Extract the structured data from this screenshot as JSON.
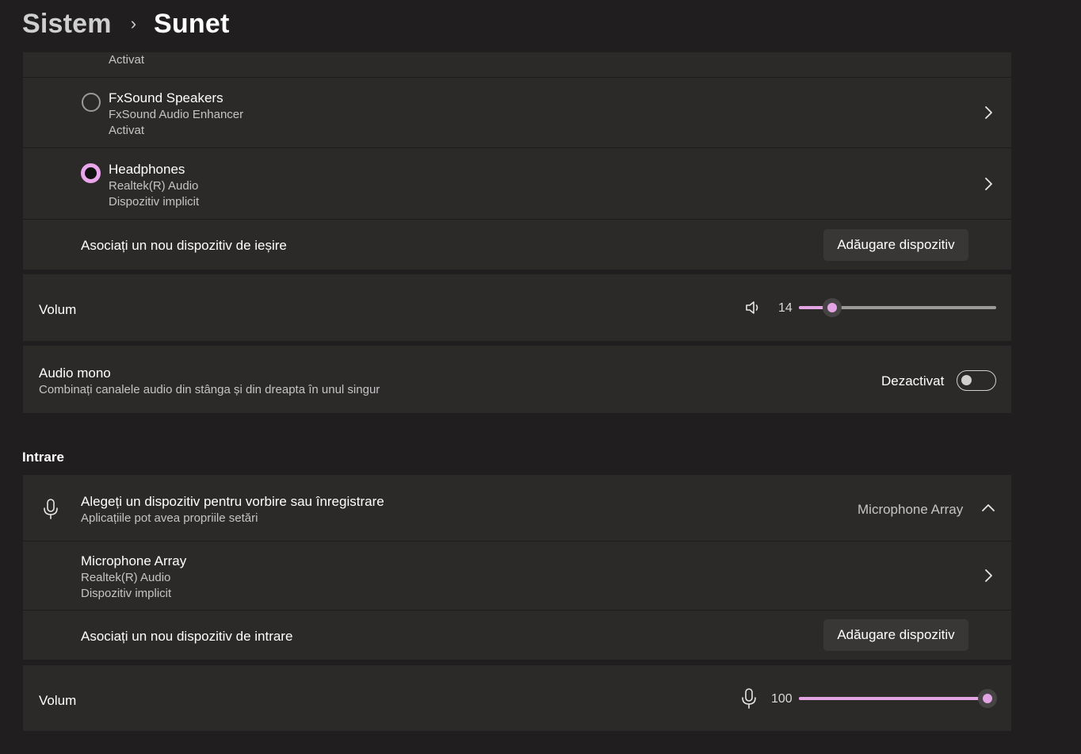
{
  "breadcrumb": {
    "parent": "Sistem",
    "separator": "›",
    "current": "Sunet"
  },
  "output": {
    "partial_status": "Activat",
    "devices": [
      {
        "name": "FxSound Speakers",
        "driver": "FxSound Audio Enhancer",
        "status": "Activat",
        "selected": false
      },
      {
        "name": "Headphones",
        "driver": "Realtek(R) Audio",
        "status": "Dispozitiv implicit",
        "selected": true
      }
    ],
    "pair_label": "Asociați un nou dispozitiv de ieșire",
    "add_button": "Adăugare dispozitiv",
    "volume": {
      "label": "Volum",
      "value": "14",
      "level": 14
    },
    "mono": {
      "title": "Audio mono",
      "description": "Combinați canalele audio din stânga și din dreapta în unul singur",
      "state": "Dezactivat"
    }
  },
  "input": {
    "section_title": "Intrare",
    "chooser": {
      "title": "Alegeți un dispozitiv pentru vorbire sau înregistrare",
      "subtitle": "Aplicațiile pot avea propriile setări",
      "selected": "Microphone Array"
    },
    "devices": [
      {
        "name": "Microphone Array",
        "driver": "Realtek(R) Audio",
        "status": "Dispozitiv implicit"
      }
    ],
    "pair_label": "Asociați un nou dispozitiv de intrare",
    "add_button": "Adăugare dispozitiv",
    "volume": {
      "label": "Volum",
      "value": "100",
      "level": 100
    }
  },
  "colors": {
    "accent": "#e2a4e2",
    "card": "#2c2a29",
    "background": "#201e1e"
  },
  "icons": [
    "chevron-right-icon",
    "speaker-icon",
    "microphone-icon",
    "chevron-up-icon"
  ]
}
